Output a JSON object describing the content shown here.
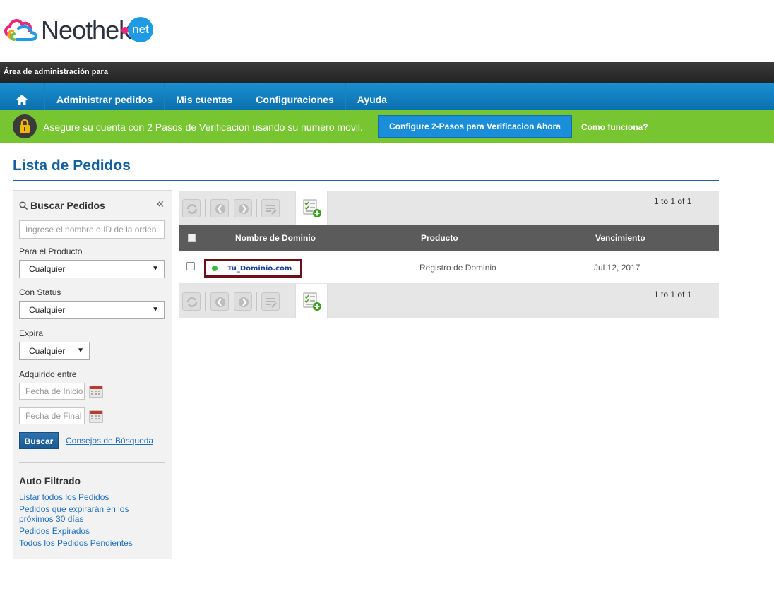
{
  "brand": {
    "logo_text": "Neothek",
    "logo_suffix": "net"
  },
  "admin_bar": {
    "text": "Área de administración para"
  },
  "nav": {
    "items": [
      {
        "label": "Administrar pedidos"
      },
      {
        "label": "Mis cuentas"
      },
      {
        "label": "Configuraciones"
      },
      {
        "label": "Ayuda"
      }
    ]
  },
  "verify": {
    "message": "Asegure su cuenta con 2 Pasos de Verificacion usando su numero movil.",
    "button": "Configure 2-Pasos para Verificacion Ahora",
    "link": "Como funciona?"
  },
  "page": {
    "title": "Lista de Pedidos"
  },
  "sidebar": {
    "heading": "Buscar Pedidos",
    "collapse": "«",
    "search_placeholder": "Ingrese el nombre o ID de la orden",
    "product_label": "Para el Producto",
    "product_value": "Cualquier",
    "status_label": "Con Status",
    "status_value": "Cualquier",
    "expires_label": "Expira",
    "expires_value": "Cualquier",
    "acquired_label": "Adquirido entre",
    "start_placeholder": "Fecha de Inicio",
    "end_placeholder": "Fecha de Final",
    "search_button": "Buscar",
    "tips_link": "Consejos de Búsqueda",
    "auto_filter_heading": "Auto Filtrado",
    "filters": [
      "Listar todos los Pedidos",
      "Pedidos que expirarán en los próximos 30 días",
      "Pedidos Expirados",
      "Todos los Pedidos Pendientes"
    ]
  },
  "table": {
    "pagination_top": "1 to 1 of 1",
    "pagination_bottom": "1 to 1 of 1",
    "columns": {
      "domain": "Nombre de Dominio",
      "product": "Producto",
      "expiry": "Vencimiento"
    },
    "rows": [
      {
        "domain": "Tu_Dominio.com",
        "product": "Registro de Dominio",
        "expiry": "Jul 12, 2017",
        "status_color": "#3bb53b"
      }
    ]
  },
  "colors": {
    "nav": "#0b6fae",
    "verify_bar": "#77c530",
    "title": "#12609e",
    "highlight_box": "#6e0e1a"
  }
}
